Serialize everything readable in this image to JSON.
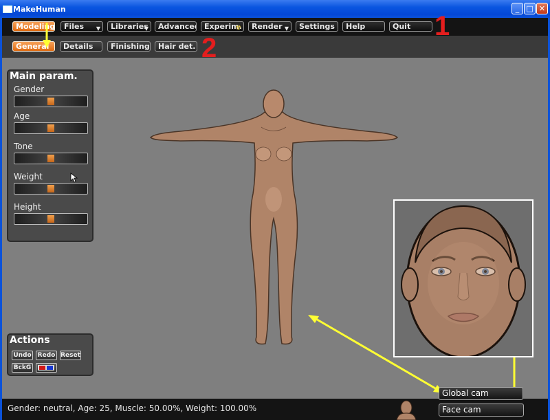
{
  "window": {
    "title": "MakeHuman",
    "controls": [
      "minimize",
      "maximize",
      "close"
    ]
  },
  "menu": {
    "items": [
      {
        "label": "Modeling",
        "active": true
      },
      {
        "label": "Files",
        "dropdown": true
      },
      {
        "label": "Libraries",
        "dropdown": true
      },
      {
        "label": "Advanced"
      },
      {
        "label": "Experim."
      },
      {
        "label": "Render",
        "dropdown": true
      },
      {
        "label": "Settings"
      },
      {
        "label": "Help"
      },
      {
        "label": "Quit"
      }
    ],
    "annotation_number": "1"
  },
  "tabs": {
    "items": [
      {
        "label": "General",
        "active": true
      },
      {
        "label": "Details"
      },
      {
        "label": "Finishing"
      },
      {
        "label": "Hair det."
      }
    ],
    "annotation_number": "2"
  },
  "main_params": {
    "title": "Main param.",
    "sliders": [
      {
        "label": "Gender",
        "value": 0.5
      },
      {
        "label": "Age",
        "value": 0.5
      },
      {
        "label": "Tone",
        "value": 0.5
      },
      {
        "label": "Weight",
        "value": 0.5
      },
      {
        "label": "Height",
        "value": 0.5
      }
    ]
  },
  "actions": {
    "title": "Actions",
    "buttons": [
      "Undo",
      "Redo",
      "Reset",
      "BckG"
    ],
    "stereo_icon": "3d-glasses-icon"
  },
  "status": {
    "text": "Gender: neutral, Age: 25, Muscle: 50.00%, Weight: 100.00%"
  },
  "cameras": {
    "global": "Global cam",
    "face": "Face cam"
  },
  "colors": {
    "accent_orange": "#e87a22",
    "annotation_red": "#e41e1e",
    "annotation_yellow": "#ffff33",
    "skin": "#b08468",
    "viewport_bg": "#7f7f7f"
  }
}
